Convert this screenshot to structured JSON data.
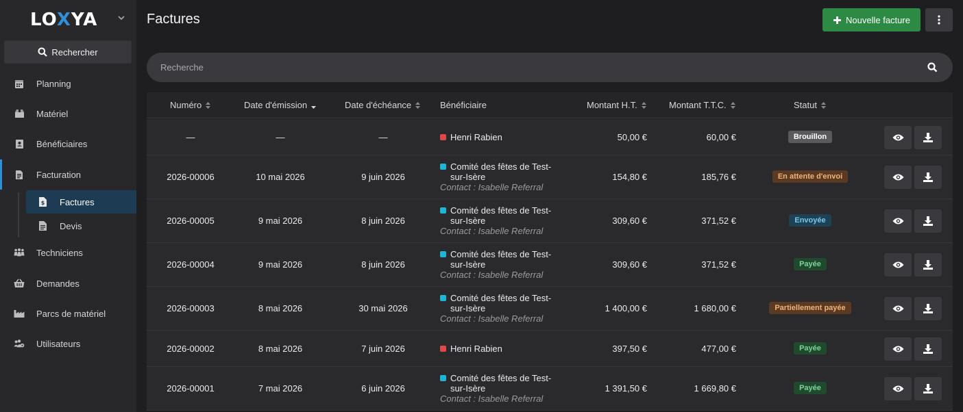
{
  "brand": {
    "name_left": "LO",
    "name_x": "X",
    "name_right": "YA"
  },
  "sidebar": {
    "search_label": "Rechercher",
    "items": [
      {
        "label": "Planning",
        "icon": "calendar-icon"
      },
      {
        "label": "Matériel",
        "icon": "box-icon"
      },
      {
        "label": "Bénéficiaires",
        "icon": "address-card-icon"
      },
      {
        "label": "Facturation",
        "icon": "invoice-icon"
      },
      {
        "label": "Techniciens",
        "icon": "people-icon"
      },
      {
        "label": "Demandes",
        "icon": "basket-icon"
      },
      {
        "label": "Parcs de matériel",
        "icon": "industry-icon"
      },
      {
        "label": "Utilisateurs",
        "icon": "users-cog-icon"
      }
    ],
    "subitems": [
      {
        "label": "Factures",
        "icon": "file-invoice-dollar-icon",
        "active": true
      },
      {
        "label": "Devis",
        "icon": "file-text-icon",
        "active": false
      }
    ]
  },
  "header": {
    "title": "Factures",
    "new_button": "Nouvelle facture"
  },
  "search": {
    "placeholder": "Recherche"
  },
  "table": {
    "columns": [
      "Numéro",
      "Date d'émission",
      "Date d'échéance",
      "Bénéficiaire",
      "Montant H.T.",
      "Montant T.T.C.",
      "Statut"
    ],
    "rows": [
      {
        "numero": "—",
        "emission": "—",
        "echeance": "—",
        "beneficiaire": "Henri Rabien",
        "dot_color": "#e04848",
        "contact": "",
        "ht": "50,00 €",
        "ttc": "60,00 €",
        "statut": "Brouillon",
        "badge_bg": "#5a5a5e",
        "badge_fg": "#ffffff"
      },
      {
        "numero": "2026-00006",
        "emission": "10 mai 2026",
        "echeance": "9 juin 2026",
        "beneficiaire": "Comité des fêtes de Test-sur-Isère",
        "dot_color": "#1fb5d6",
        "contact": "Contact : Isabelle Referral",
        "ht": "154,80 €",
        "ttc": "185,76 €",
        "statut": "En attente d'envoi",
        "badge_bg": "#5a3a22",
        "badge_fg": "#f0b37a"
      },
      {
        "numero": "2026-00005",
        "emission": "9 mai 2026",
        "echeance": "8 juin 2026",
        "beneficiaire": "Comité des fêtes de Test-sur-Isère",
        "dot_color": "#1fb5d6",
        "contact": "Contact : Isabelle Referral",
        "ht": "309,60 €",
        "ttc": "371,52 €",
        "statut": "Envoyée",
        "badge_bg": "#1d4256",
        "badge_fg": "#7cc7ea"
      },
      {
        "numero": "2026-00004",
        "emission": "9 mai 2026",
        "echeance": "8 juin 2026",
        "beneficiaire": "Comité des fêtes de Test-sur-Isère",
        "dot_color": "#1fb5d6",
        "contact": "Contact : Isabelle Referral",
        "ht": "309,60 €",
        "ttc": "371,52 €",
        "statut": "Payée",
        "badge_bg": "#1f4a2e",
        "badge_fg": "#7fd39a"
      },
      {
        "numero": "2026-00003",
        "emission": "8 mai 2026",
        "echeance": "30 mai 2026",
        "beneficiaire": "Comité des fêtes de Test-sur-Isère",
        "dot_color": "#1fb5d6",
        "contact": "Contact : Isabelle Referral",
        "ht": "1 400,00 €",
        "ttc": "1 680,00 €",
        "statut": "Partiellement payée",
        "badge_bg": "#5a3a22",
        "badge_fg": "#f0b37a"
      },
      {
        "numero": "2026-00002",
        "emission": "8 mai 2026",
        "echeance": "7 juin 2026",
        "beneficiaire": "Henri Rabien",
        "dot_color": "#e04848",
        "contact": "",
        "ht": "397,50 €",
        "ttc": "477,00 €",
        "statut": "Payée",
        "badge_bg": "#1f4a2e",
        "badge_fg": "#7fd39a"
      },
      {
        "numero": "2026-00001",
        "emission": "7 mai 2026",
        "echeance": "6 juin 2026",
        "beneficiaire": "Comité des fêtes de Test-sur-Isère",
        "dot_color": "#1fb5d6",
        "contact": "Contact : Isabelle Referral",
        "ht": "1 391,50 €",
        "ttc": "1 669,80 €",
        "statut": "Payée",
        "badge_bg": "#1f4a2e",
        "badge_fg": "#7fd39a"
      }
    ]
  },
  "colors": {
    "accent": "#2f8fd8",
    "primary_button": "#2d8a45"
  }
}
